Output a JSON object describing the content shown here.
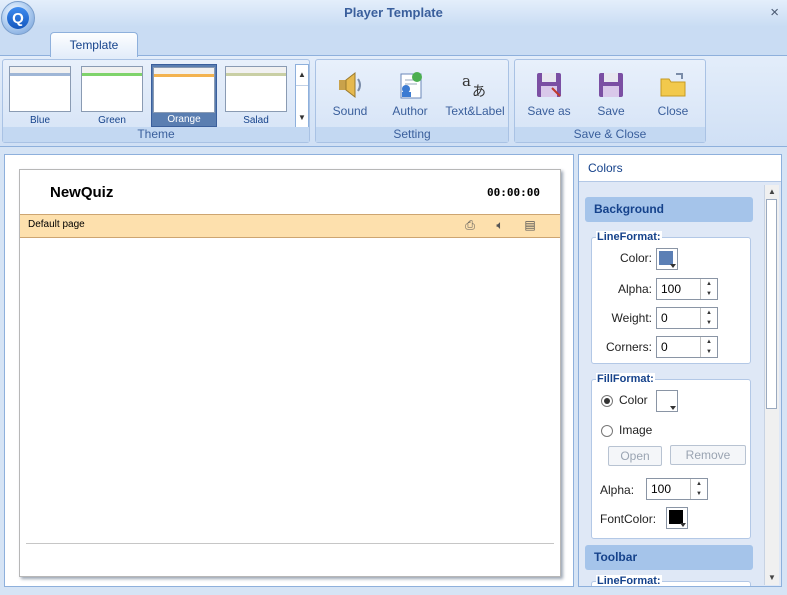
{
  "window": {
    "title": "Player Template",
    "close_symbol": "×"
  },
  "ribbon": {
    "tab": "Template",
    "theme_group": {
      "label": "Theme",
      "themes": [
        {
          "name": "Blue",
          "accent": "#9fb6d6"
        },
        {
          "name": "Green",
          "accent": "#7fd36b"
        },
        {
          "name": "Orange",
          "accent": "#f3b350",
          "selected": true
        },
        {
          "name": "Salad",
          "accent": "#c9cfa4"
        }
      ]
    },
    "setting_group": {
      "label": "Setting",
      "buttons": [
        {
          "label": "Sound",
          "icon": "speaker-icon"
        },
        {
          "label": "Author",
          "icon": "author-icon"
        },
        {
          "label": "Text&Label",
          "icon": "text-label-icon"
        }
      ]
    },
    "save_group": {
      "label": "Save & Close",
      "buttons": [
        {
          "label": "Save as",
          "icon": "save-as-icon"
        },
        {
          "label": "Save",
          "icon": "save-icon"
        },
        {
          "label": "Close",
          "icon": "folder-close-icon"
        }
      ]
    }
  },
  "preview": {
    "quiz_title": "NewQuiz",
    "timer": "00:00:00",
    "page_label": "Default page",
    "toolbar_icons": [
      "print-icon",
      "sound-icon",
      "card-icon"
    ],
    "bar_color": "#fde0ad"
  },
  "colors_panel": {
    "title": "Colors",
    "background": {
      "header": "Background",
      "line_format": {
        "legend": "LineFormat:",
        "color_label": "Color:",
        "color_value": "#5b7fb5",
        "alpha_label": "Alpha:",
        "alpha": "100",
        "weight_label": "Weight:",
        "weight": "0",
        "corners_label": "Corners:",
        "corners": "0"
      },
      "fill_format": {
        "legend": "FillFormat:",
        "color_option": "Color",
        "color_selected": true,
        "color_value": "#ffffff",
        "image_option": "Image",
        "open_button": "Open",
        "remove_button": "Remove",
        "alpha_label": "Alpha:",
        "alpha": "100",
        "font_color_label": "FontColor:",
        "font_color_value": "#000000"
      }
    },
    "toolbar": {
      "header": "Toolbar",
      "line_format_legend": "LineFormat:"
    }
  }
}
